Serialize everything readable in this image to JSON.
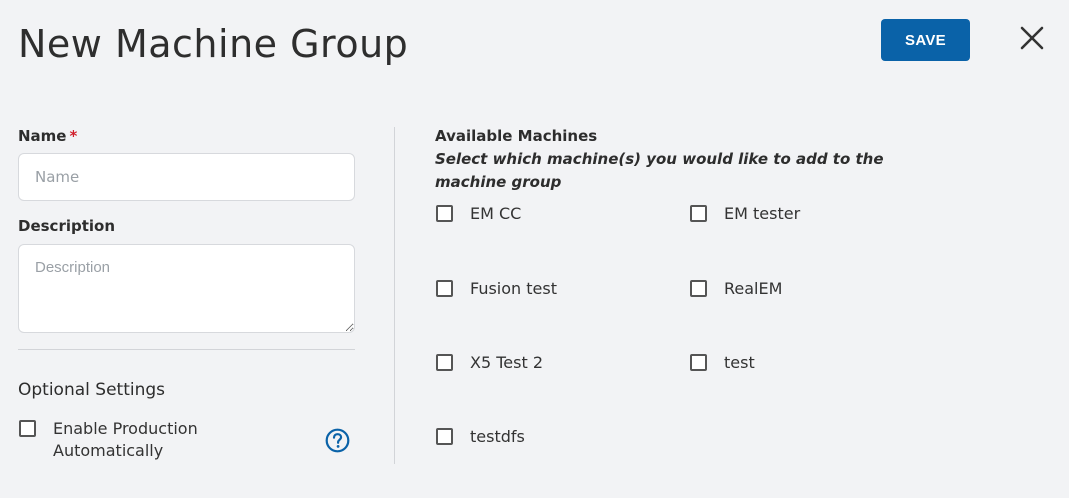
{
  "header": {
    "title": "New Machine Group",
    "save_label": "SAVE"
  },
  "form": {
    "name": {
      "label": "Name",
      "required_marker": "*",
      "placeholder": "Name",
      "value": ""
    },
    "description": {
      "label": "Description",
      "placeholder": "Description",
      "value": ""
    }
  },
  "optional_settings": {
    "title": "Optional Settings",
    "enable_production": {
      "label_line1": "Enable Production",
      "label_line2": "Automatically",
      "checked": false
    },
    "help_icon": "question-circle-icon"
  },
  "available_machines": {
    "title": "Available Machines",
    "subtitle_line1": "Select which machine(s) you would like to add to the",
    "subtitle_line2": "machine group",
    "machines": [
      {
        "label": "EM CC",
        "checked": false
      },
      {
        "label": "EM tester",
        "checked": false
      },
      {
        "label": "Fusion test",
        "checked": false
      },
      {
        "label": "RealEM",
        "checked": false
      },
      {
        "label": "X5 Test 2",
        "checked": false
      },
      {
        "label": "test",
        "checked": false
      },
      {
        "label": "testdfs",
        "checked": false
      }
    ]
  },
  "colors": {
    "accent": "#0a62a8",
    "required": "#d11f2c",
    "background": "#f2f3f5"
  }
}
